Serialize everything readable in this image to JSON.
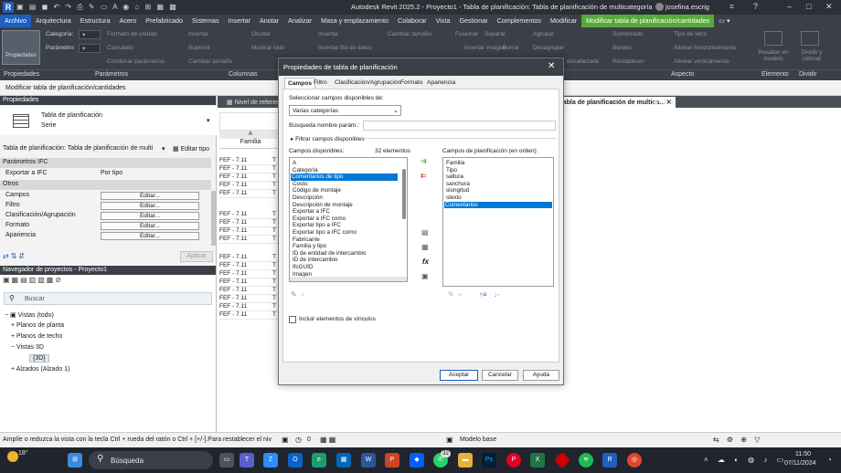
{
  "titlebar": {
    "logo": "R",
    "title": "Autodesk Revit 2025.2 - Proyecto1 - Tabla de planificación: Tabla de planificación de multicategoría",
    "user": "josefina.escrig"
  },
  "menu": [
    "Archivo",
    "Arquitectura",
    "Estructura",
    "Acero",
    "Prefabricado",
    "Sistemas",
    "Insertar",
    "Anotar",
    "Analizar",
    "Masa y emplazamiento",
    "Colaborar",
    "Vista",
    "Gestionar",
    "Complementos",
    "Modificar",
    "Modificar tabla de planificación/cantidades"
  ],
  "ribbon": {
    "propiedades": "Propiedades",
    "categoria": "Categoría:",
    "parametro": "Parámetro:",
    "formato_unidad": "Formato de unidad",
    "calculado": "Calculado",
    "combinar": "Combinar parámetros",
    "insertar": "Insertar",
    "suprimir": "Suprimir",
    "cambiar_tamano": "Cambiar tamaño",
    "ocultar": "Ocultar",
    "mostrar_todo": "Mostrar todo",
    "insertar2": "Insertar",
    "insertar_fila": "Insertar fila de datos",
    "cambiar_tamano2": "Cambiar tamaño",
    "fusionar": "Fusionar",
    "separar": "Separar",
    "insertar_imagen": "Insertar imagen",
    "borrar": "Borrar",
    "agrupar": "Agrupar",
    "desagrupar": "Desagrupar",
    "encabezado": "encabezado",
    "sombreado": "Sombreado",
    "bordes": "Bordes",
    "restablecer": "Restablecer",
    "tipo_letra": "Tipo de letra",
    "alinear_h": "Alinear horizontalmente",
    "alinear_v": "Alinear verticalmente",
    "resaltar": "Resaltar en modelo",
    "dividir": "Dividir y colocar",
    "groups": [
      "Propiedades",
      "Parámetros",
      "Columnas",
      "Aspecto",
      "Elemento",
      "Dividir"
    ]
  },
  "context_bar": "Modificar tabla de planificación/cantidades",
  "properties": {
    "header": "Propiedades",
    "type_name": "Tabla de planificación",
    "type_sub": "Serie",
    "instance_label": "Tabla de planificación: Tabla de planificación de multi",
    "edit_type": "Editar tipo",
    "ifc_header": "Parámetros IFC",
    "export_ifc": "Exportar a IFC",
    "por_tipo": "Por tipo",
    "otros": "Otros",
    "rows": [
      {
        "label": "Campos",
        "btn": "Editar..."
      },
      {
        "label": "Filtro",
        "btn": "Editar..."
      },
      {
        "label": "Clasificación/Agrupación",
        "btn": "Editar..."
      },
      {
        "label": "Formato",
        "btn": "Editar..."
      },
      {
        "label": "Apariencia",
        "btn": "Editar..."
      }
    ],
    "apply": "Aplicar"
  },
  "browser": {
    "header": "Navegador de proyectos - Proyecto1",
    "search": "Buscar",
    "items": [
      "Vistas (todo)",
      "Planos de planta",
      "Planos de techo",
      "Vistas 3D",
      "{3D}",
      "Alzados (Alzado 1)"
    ]
  },
  "view_tabs": [
    "Nivel de referencia",
    "Tabla de planificación de multica...",
    "{3D}"
  ],
  "schedule": {
    "col_letter": "A",
    "col_header": "Familia",
    "rows": [
      "FEF - 7.11",
      "FEF - 7.11",
      "FEF - 7.11",
      "FEF - 7.11",
      "FEF - 7.11",
      "FEF - 7.11",
      "FEF - 7.11",
      "FEF - 7.11",
      "FEF - 7.11",
      "FEF - 7.11",
      "FEF - 7.11",
      "FEF - 7.11",
      "FEF - 7.11",
      "FEF - 7.11",
      "FEF - 7.11",
      "FEF - 7.11",
      "FEF - 7.11"
    ],
    "col2_first": "T"
  },
  "dialog": {
    "title": "Propiedades de tabla de planificación",
    "tabs": [
      "Campos",
      "Filtro",
      "Clasificación/Agrupación",
      "Formato",
      "Apariencia"
    ],
    "select_label": "Seleccionar campos disponibles de:",
    "select_value": "Varias categorías",
    "search_label": "Búsqueda nombre parám.:",
    "filter_label": "Filtrar campos disponibles",
    "available_label": "Campos disponibles:",
    "available_count": "32 elementos",
    "available": [
      "A",
      "Categoría",
      "Comentarios de tipo",
      "Costo",
      "Código de montaje",
      "Descripción",
      "Descripción de montaje",
      "Exportar a IFC",
      "Exportar a IFC como",
      "Exportar tipo a IFC",
      "Exportar tipo a IFC como",
      "Fabricante",
      "Familia y tipo",
      "ID de entidad de intercambio",
      "ID de intercambio",
      "IfcGUID",
      "Imagen"
    ],
    "available_selected": "Comentarios de tipo",
    "scheduled_label": "Campos de planificación (en orden):",
    "scheduled": [
      "Familia",
      "Tipo",
      "saltura",
      "sanchura",
      "slongitud",
      "stexto",
      "Comentarios"
    ],
    "scheduled_selected": "Comentarios",
    "links_label": "Incluir elementos de vínculos",
    "ok": "Aceptar",
    "cancel": "Cancelar",
    "help": "Ayuda"
  },
  "status": {
    "hint": "Amplíe o reduzca la vista con la tecla Ctrl + rueda del ratón o Ctrl + [+/-].Para restablecer el niv",
    "zero": "0",
    "model": "Modelo base"
  },
  "taskbar": {
    "weather": "18°",
    "search": "Búsqueda",
    "time": "11:50",
    "date": "07/11/2024",
    "badge": "32",
    "zoom": "100%"
  }
}
